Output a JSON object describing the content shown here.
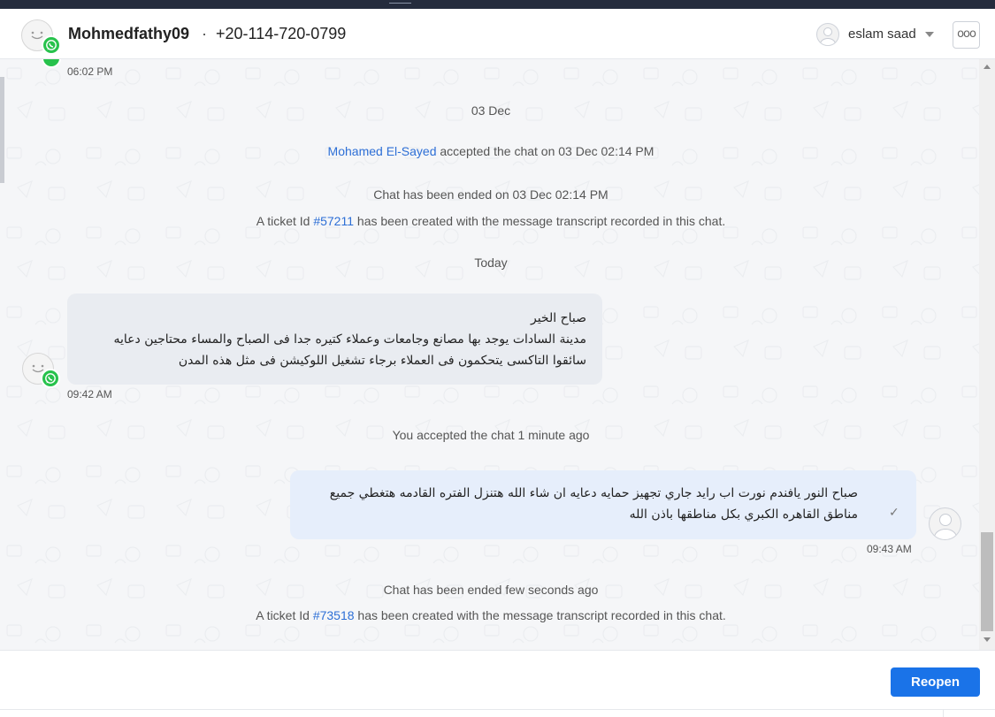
{
  "header": {
    "contact_name": "Mohmedfathy09",
    "separator": "·",
    "contact_phone": "+20-114-720-0799",
    "agent_name": "eslam saad",
    "more_label": "ooo"
  },
  "messages": {
    "prev_time": "06:02 PM",
    "date_divider": "03 Dec",
    "accepted_agent": "Mohamed El-Sayed",
    "accepted_text": " accepted the chat on 03 Dec 02:14 PM",
    "ended_1": "Chat has been ended on 03 Dec 02:14 PM",
    "ticket_1_prefix": "A ticket Id ",
    "ticket_1_id": "#57211",
    "ticket_1_suffix": " has been created with the message transcript recorded in this chat.",
    "today_divider": "Today",
    "incoming": {
      "lines": [
        "صباح الخير",
        "مدينة السادات يوجد بها مصانع وجامعات وعملاء كتيره جدا فى الصباح والمساء محتاجين دعايه",
        "سائقوا التاكسى يتحكمون فى العملاء برجاء تشغيل اللوكيشن فى مثل هذه المدن"
      ],
      "time": "09:42 AM"
    },
    "you_accepted": "You accepted the chat 1 minute ago",
    "outgoing": {
      "lines": [
        "صباح النور يافندم نورت اب رايد جاري تجهيز حمايه دعايه ان شاء الله هتنزل الفتره القادمه هتغطي جميع",
        "مناطق القاهره الكبري بكل مناطقها باذن الله"
      ],
      "time": "09:43 AM",
      "status_icon": "✓"
    },
    "ended_2": "Chat has been ended few seconds ago",
    "ticket_2_prefix": "A ticket Id ",
    "ticket_2_id": "#73518",
    "ticket_2_suffix": " has been created with the message transcript recorded in this chat."
  },
  "footer": {
    "reopen_label": "Reopen"
  },
  "colors": {
    "brand_blue": "#1a73e8",
    "link_blue": "#2d6fd6",
    "whatsapp_green": "#27c24c",
    "topbar": "#252c3d"
  },
  "icons": [
    "user-avatar-icon",
    "whatsapp-icon",
    "agent-avatar-icon",
    "caret-down-icon",
    "more-options-icon",
    "check-icon"
  ]
}
